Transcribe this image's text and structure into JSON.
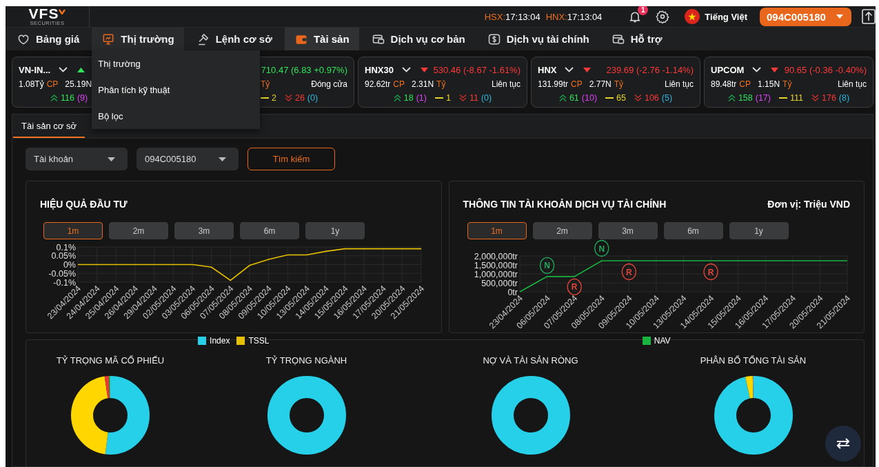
{
  "header": {
    "logo": "VFS",
    "logo_tagline": "SECURITIES",
    "clocks": [
      {
        "label": "HSX:",
        "time": "17:13:04"
      },
      {
        "label": "HNX:",
        "time": "17:13:04"
      }
    ],
    "notification_count": "1",
    "language": "Tiếng Việt",
    "account": "094C005180"
  },
  "nav": [
    {
      "label": "Bảng giá",
      "selected": false,
      "expanded": false
    },
    {
      "label": "Thị trường",
      "selected": false,
      "expanded": true
    },
    {
      "label": "Lệnh cơ sở",
      "selected": false,
      "expanded": false
    },
    {
      "label": "Tài sản",
      "selected": true,
      "expanded": false
    },
    {
      "label": "Dịch vụ cơ bản",
      "selected": false,
      "expanded": false
    },
    {
      "label": "Dịch vụ tài chính",
      "selected": false,
      "expanded": false
    },
    {
      "label": "Hỗ trợ",
      "selected": false,
      "expanded": false
    }
  ],
  "nav_menu": {
    "items": [
      "Thị trường",
      "Phân tích kỹ thuật",
      "Bộ lọc"
    ]
  },
  "cards": [
    {
      "name": "VN-IN...",
      "rising": true,
      "volume": "1.08Tỷ",
      "volume_unit": "CP",
      "value": "25.19N",
      "advancing": "116",
      "ceiling": "(9)"
    },
    {
      "rising": true,
      "index_value": "710.47 (6.83 +0.97%)",
      "value_unit": "Tỷ",
      "status": "Đóng cửa",
      "unchanged": "2",
      "declining": "26",
      "floor": "(0)"
    },
    {
      "name": "HNX30",
      "rising": false,
      "index_value": "530.46 (-8.67 -1.61%)",
      "volume": "92.62tr",
      "volume_unit": "CP",
      "value": "2.31N",
      "value_unit": "Tỷ",
      "status": "Liên tục",
      "advancing": "18",
      "ceiling": "(1)",
      "unchanged": "1",
      "declining": "11",
      "floor": "(0)"
    },
    {
      "name": "HNX",
      "rising": false,
      "index_value": "239.69 (-2.76 -1.14%)",
      "volume": "131.99tr",
      "volume_unit": "CP",
      "value": "2.77N",
      "value_unit": "Tỷ",
      "status": "Liên tục",
      "advancing": "61",
      "ceiling": "(10)",
      "unchanged": "65",
      "declining": "106",
      "floor": "(5)"
    },
    {
      "name": "UPCOM",
      "rising": false,
      "index_value": "90.65 (-0.36 -0.40%)",
      "volume": "89.48tr",
      "volume_unit": "CP",
      "value": "1.15N",
      "value_unit": "Tỷ",
      "status": "Liên tục",
      "advancing": "158",
      "ceiling": "(17)",
      "unchanged": "111",
      "declining": "176",
      "floor": "(8)"
    }
  ],
  "sub_tabs": [
    {
      "label": "Tài sản cơ sở",
      "selected": true
    }
  ],
  "filter": {
    "account_type": "Tài khoản",
    "account_number": "094C005180",
    "search_button": "Tìm kiếm"
  },
  "charts": [
    {
      "title": "HIỆU QUẢ ĐẦU TƯ",
      "ranges": [
        {
          "label": "1m",
          "selected": true
        },
        {
          "label": "2m",
          "selected": false
        },
        {
          "label": "3m",
          "selected": false
        },
        {
          "label": "6m",
          "selected": false
        },
        {
          "label": "1y",
          "selected": false
        }
      ],
      "chart_data": {
        "type": "line",
        "categories": [
          "23/04/2024",
          "24/04/2024",
          "25/04/2024",
          "26/04/2024",
          "29/04/2024",
          "02/05/2024",
          "03/05/2024",
          "06/05/2024",
          "07/05/2024",
          "08/05/2024",
          "09/05/2024",
          "10/05/2024",
          "13/05/2024",
          "14/05/2024",
          "15/05/2024",
          "16/05/2024",
          "17/05/2024",
          "20/05/2024",
          "21/05/2024"
        ],
        "series": [
          {
            "name": "Index",
            "color": "#26d0e8",
            "values": [
              null,
              null,
              null,
              null,
              null,
              null,
              null,
              null,
              null,
              null,
              null,
              null,
              null,
              null,
              null,
              null,
              null,
              null,
              null
            ]
          },
          {
            "name": "TSSL",
            "color": "#e6bf00",
            "values": [
              0,
              0,
              0,
              0,
              0,
              0,
              0,
              -0.015,
              -0.09,
              -0.005,
              0.03,
              0.055,
              0.055,
              0.075,
              0.09,
              0.09,
              0.09,
              0.09,
              0.09
            ]
          }
        ],
        "ylim": [
          -0.1,
          0.1
        ],
        "grid": true,
        "yticks": [
          {
            "value": 0.1,
            "label": "0.1%"
          },
          {
            "value": 0.05,
            "label": "0.05%"
          },
          {
            "value": 0,
            "label": "0%"
          },
          {
            "value": -0.05,
            "label": "-0.05%"
          },
          {
            "value": -0.1,
            "label": "-0.1%"
          }
        ]
      }
    },
    {
      "title": "THÔNG TIN TÀI KHOẢN DỊCH VỤ TÀI CHÍNH",
      "unit": "Đơn vị: Triệu VND",
      "ranges": [
        {
          "label": "1m",
          "selected": true
        },
        {
          "label": "2m",
          "selected": false
        },
        {
          "label": "3m",
          "selected": false
        },
        {
          "label": "6m",
          "selected": false
        },
        {
          "label": "1y",
          "selected": false
        }
      ],
      "chart_data": {
        "type": "line",
        "categories": [
          "23/04/2024",
          "06/05/2024",
          "07/05/2024",
          "08/05/2024",
          "09/05/2024",
          "10/05/2024",
          "13/05/2024",
          "14/05/2024",
          "15/05/2024",
          "16/05/2024",
          "17/05/2024",
          "20/05/2024",
          "21/05/2024"
        ],
        "series": [
          {
            "name": "NAV",
            "color": "#19b33f",
            "values": [
              0,
              850000,
              850000,
              1730000,
              1730000,
              1730000,
              1730000,
              1730000,
              1730000,
              1730000,
              1730000,
              1730000,
              1730000
            ]
          }
        ],
        "ylim": [
          0,
          2000000
        ],
        "grid": true,
        "yticks": [
          {
            "value": 2000000,
            "label": "2,000,000tr"
          },
          {
            "value": 1500000,
            "label": "1,500,000tr"
          },
          {
            "value": 1000000,
            "label": "1,000,000tr"
          },
          {
            "value": 500000,
            "label": "500,000tr"
          },
          {
            "value": 0,
            "label": "0tr"
          }
        ],
        "annotations": [
          "N",
          "R",
          "N",
          "R",
          "R"
        ]
      }
    }
  ],
  "donuts": [
    {
      "title": "TỶ TRỌNG MÃ CỔ PHIẾU"
    },
    {
      "title": "TỶ TRỌNG NGÀNH"
    },
    {
      "title": "NỢ VÀ TÀI SẢN RÒNG"
    },
    {
      "title": "PHÂN BỔ TỔNG TÀI SẢN"
    }
  ]
}
